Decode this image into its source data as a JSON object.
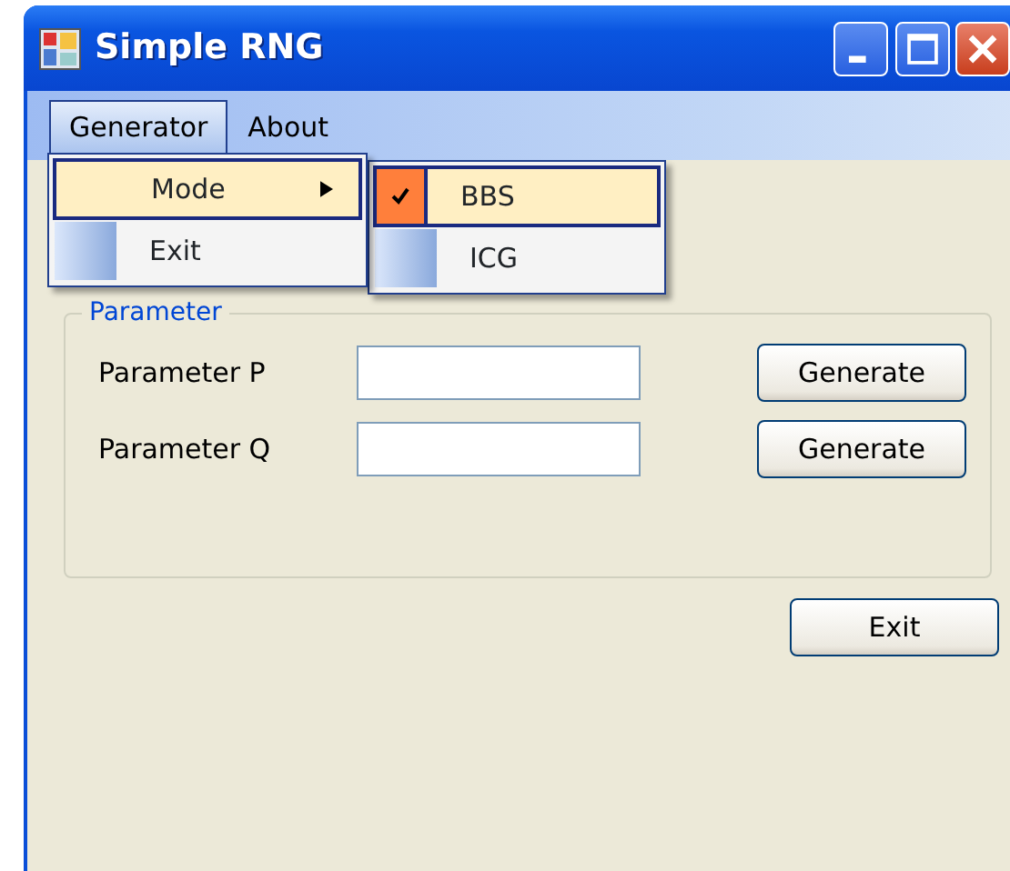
{
  "window": {
    "title": "Simple RNG"
  },
  "menu_bar": [
    {
      "label": "Generator",
      "open": true,
      "items": [
        {
          "label": "Mode",
          "selected": true,
          "submenu": [
            {
              "label": "BBS",
              "checked": true,
              "selected": true
            },
            {
              "label": "ICG",
              "checked": false,
              "selected": false
            }
          ]
        },
        {
          "label": "Exit",
          "selected": false
        }
      ]
    },
    {
      "label": "About",
      "open": false
    }
  ],
  "group": {
    "legend": "Parameter",
    "rows": [
      {
        "label": "Parameter P",
        "button": "Generate"
      },
      {
        "label": "Parameter Q",
        "button": "Generate"
      }
    ]
  },
  "buttons": [
    "Exit"
  ]
}
